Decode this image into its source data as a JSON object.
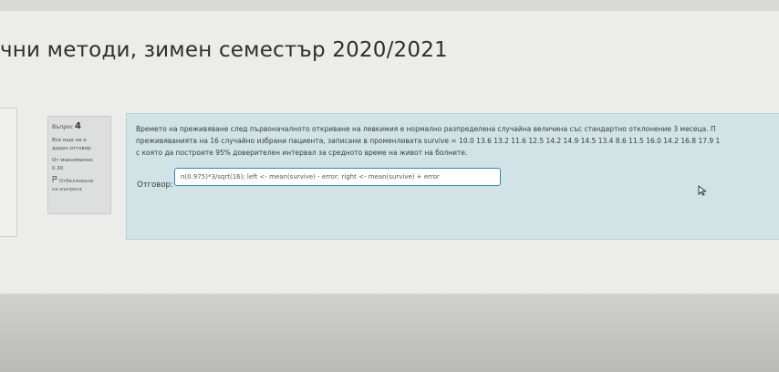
{
  "page": {
    "title": "чни методи, зимен семестър 2020/2021"
  },
  "question_info": {
    "label": "Въпрос",
    "number": "4",
    "status_line1": "Все още не е",
    "status_line2": "даден отговор",
    "max_points_label": "От максимално",
    "max_points_value": "0.30",
    "flag_line1": "Отбелязване",
    "flag_line2": "на въпроса",
    "flag_icon": "flag-icon"
  },
  "question": {
    "line1": "Времето на преживяване след първоначалното откриване на левкимия е нормално разпределена случайна величина със стандартно отклонение 3 месеца. П",
    "line2": "преживяванията на 16 случайно избрани пациента, записани в променливата survive = 10.0 13.6 13.2 11.6 12.5 14.2 14.9 14.5 13.4 8.6 11.5 16.0 14.2 16.8 17.9 1",
    "line3": "с която да построите 95% доверителен интервал за средното време на живот на болните."
  },
  "answer": {
    "label": "Отговор:",
    "value": "n(0.975)*3/sqrt(16); left <- mean(survive) - error; right <- mean(survive) + error"
  },
  "colors": {
    "content_bg": "#d0e4e5",
    "input_border": "#3a7fbf"
  }
}
